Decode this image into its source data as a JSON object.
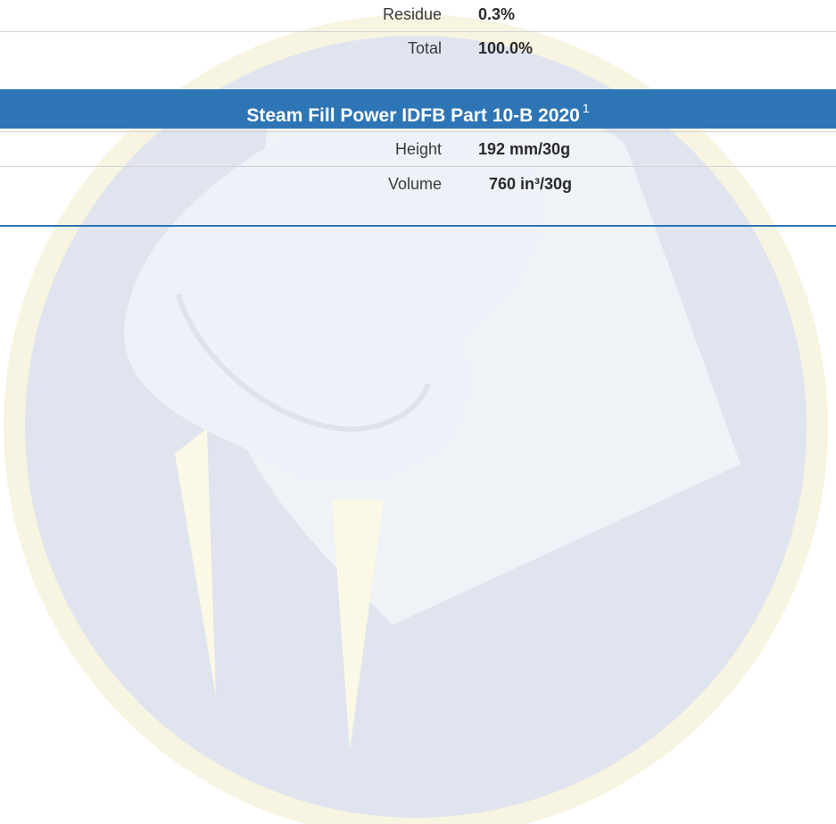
{
  "composition_rows": [
    {
      "label": "Residue",
      "value": "0.3%"
    },
    {
      "label": "Total",
      "value": "100.0%"
    }
  ],
  "steam_section": {
    "title": "Steam Fill Power IDFB Part 10-B 2020",
    "footnote_marker": "1",
    "rows": [
      {
        "label": "Height",
        "value": "192 mm/30g"
      },
      {
        "label": "Volume",
        "value": "760 in³/30g"
      }
    ]
  },
  "watermark": {
    "icon": "walrus-logo",
    "colors": {
      "circle": "#dfe4ee",
      "ring": "#f7f4e2",
      "head": "#eff2f7",
      "tusks": "#fbf9e6"
    }
  },
  "colors": {
    "header_bg": "#2e75b6",
    "header_text": "#ffffff",
    "divider": "#d2d2d2"
  }
}
